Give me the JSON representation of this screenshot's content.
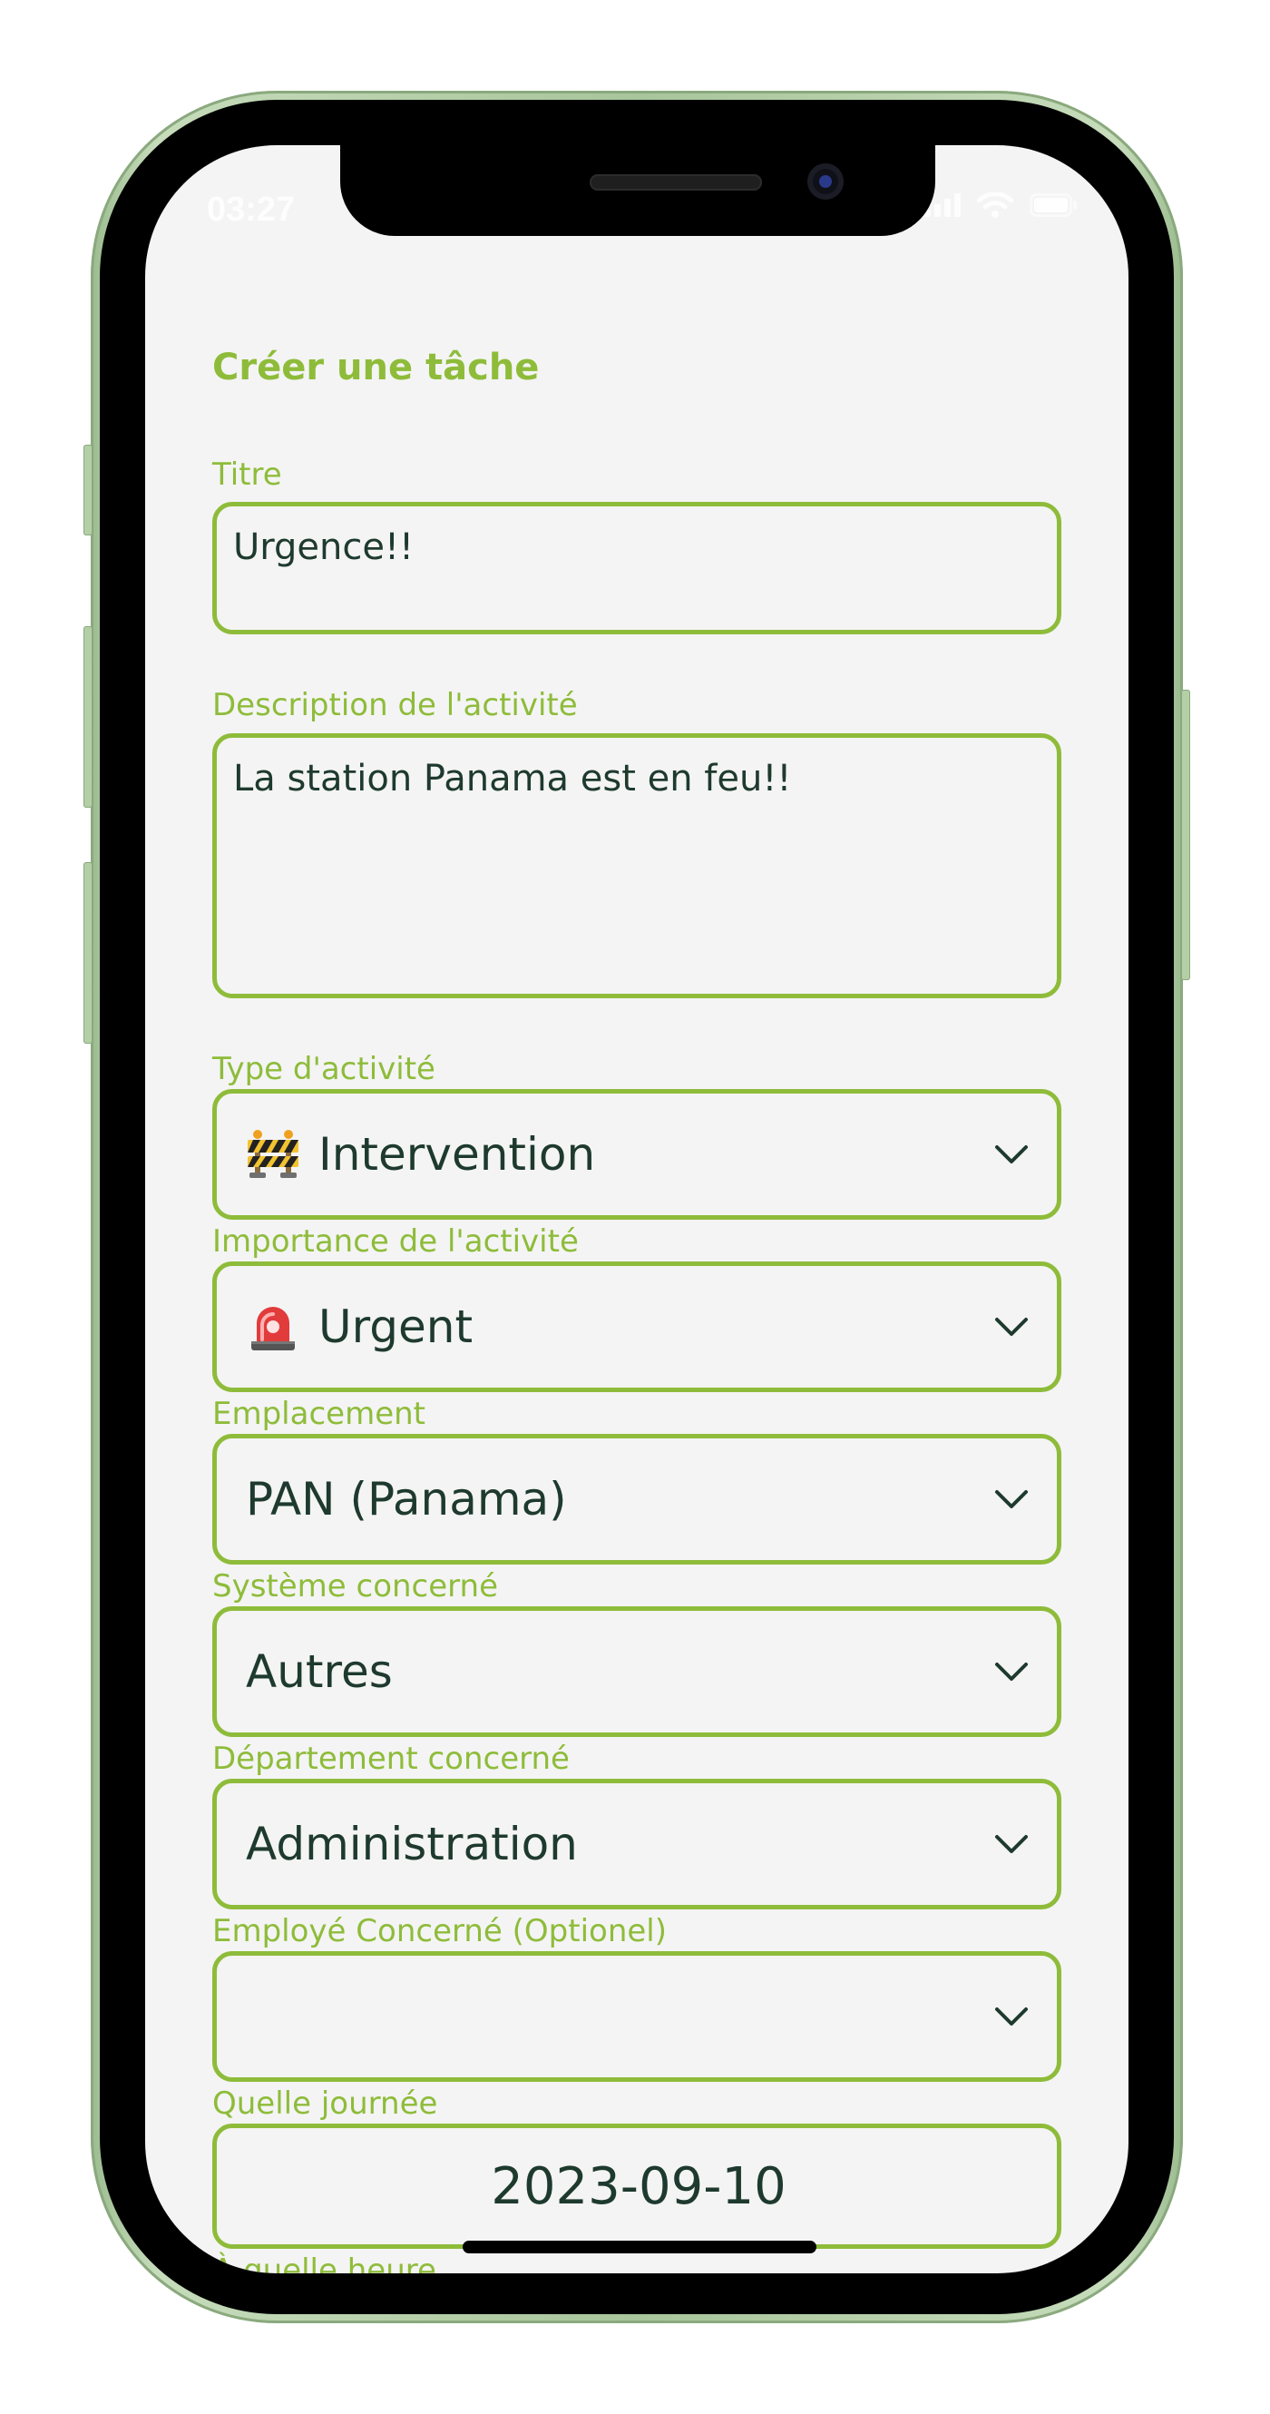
{
  "status_bar": {
    "time": "03:27",
    "icons": [
      "signal-icon",
      "wifi-icon",
      "battery-icon"
    ]
  },
  "page": {
    "title": "Créer une tâche"
  },
  "form": {
    "title_field": {
      "label": "Titre",
      "value": "Urgence!!"
    },
    "description_field": {
      "label": "Description de l'activité",
      "value": "La station Panama est en feu!!"
    },
    "activity_type": {
      "label": "Type d'activité",
      "icon": "construction-barrier-emoji",
      "value": "Intervention"
    },
    "importance": {
      "label": "Importance de l'activité",
      "icon": "police-light-emoji",
      "value": "Urgent"
    },
    "location": {
      "label": "Emplacement",
      "value": "PAN (Panama)"
    },
    "system": {
      "label": "Système concerné",
      "value": "Autres"
    },
    "department": {
      "label": "Département concerné",
      "value": "Administration"
    },
    "employee": {
      "label": "Employé Concerné (Optionel)",
      "value": ""
    },
    "day": {
      "label": "Quelle journée",
      "value": "2023-09-10"
    },
    "time": {
      "label": "À quelle heure"
    }
  },
  "colors": {
    "accent": "#8ebc3a",
    "text": "#1e3a2e",
    "background": "#f4f4f4",
    "device_frame": "#a8c59b"
  }
}
